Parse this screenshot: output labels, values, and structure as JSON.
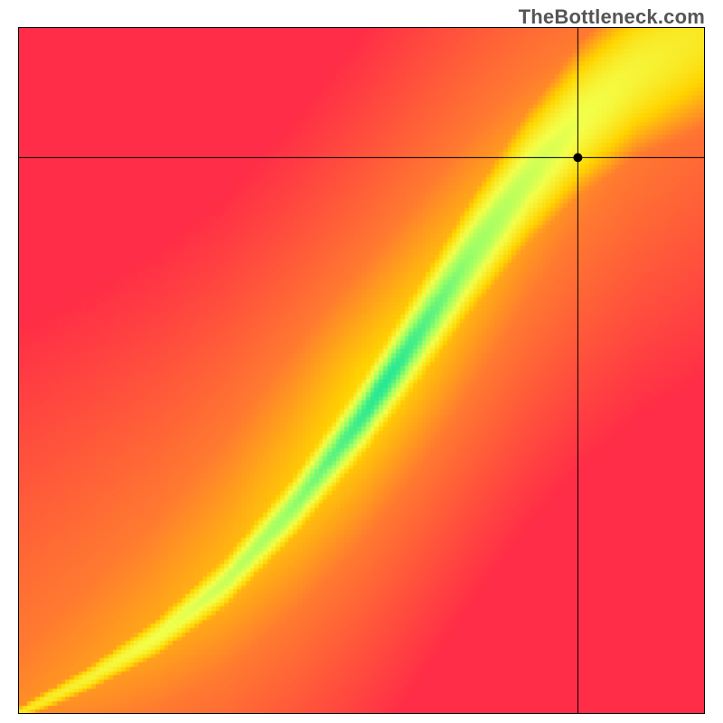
{
  "watermark": "TheBottleneck.com",
  "chart_data": {
    "type": "heatmap",
    "title": "",
    "xlabel": "",
    "ylabel": "",
    "xlim": [
      0,
      1
    ],
    "ylim": [
      0,
      1
    ],
    "grid": false,
    "legend": false,
    "description": "Square heatmap where color indicates balance: green = ideal match, red = severe mismatch, yellow = moderate bottleneck. Green optimal band follows a roughly diagonal ridge from bottom-left to top-right.",
    "color_stops": [
      {
        "t": 0.0,
        "color": "#ff2d47"
      },
      {
        "t": 0.35,
        "color": "#ff7a30"
      },
      {
        "t": 0.55,
        "color": "#ffd400"
      },
      {
        "t": 0.75,
        "color": "#f3ff4a"
      },
      {
        "t": 0.88,
        "color": "#9dff66"
      },
      {
        "t": 1.0,
        "color": "#16e59a"
      }
    ],
    "ridge": [
      {
        "x": 0.0,
        "y": 0.0,
        "w": 0.005
      },
      {
        "x": 0.1,
        "y": 0.05,
        "w": 0.012
      },
      {
        "x": 0.2,
        "y": 0.11,
        "w": 0.02
      },
      {
        "x": 0.3,
        "y": 0.19,
        "w": 0.028
      },
      {
        "x": 0.4,
        "y": 0.3,
        "w": 0.035
      },
      {
        "x": 0.5,
        "y": 0.43,
        "w": 0.045
      },
      {
        "x": 0.58,
        "y": 0.55,
        "w": 0.055
      },
      {
        "x": 0.66,
        "y": 0.67,
        "w": 0.065
      },
      {
        "x": 0.74,
        "y": 0.78,
        "w": 0.075
      },
      {
        "x": 0.82,
        "y": 0.87,
        "w": 0.085
      },
      {
        "x": 0.9,
        "y": 0.94,
        "w": 0.095
      },
      {
        "x": 1.0,
        "y": 1.0,
        "w": 0.11
      }
    ],
    "crosshair": {
      "x": 0.815,
      "y": 0.81
    },
    "marker": {
      "x": 0.815,
      "y": 0.81
    },
    "resolution": 160
  }
}
